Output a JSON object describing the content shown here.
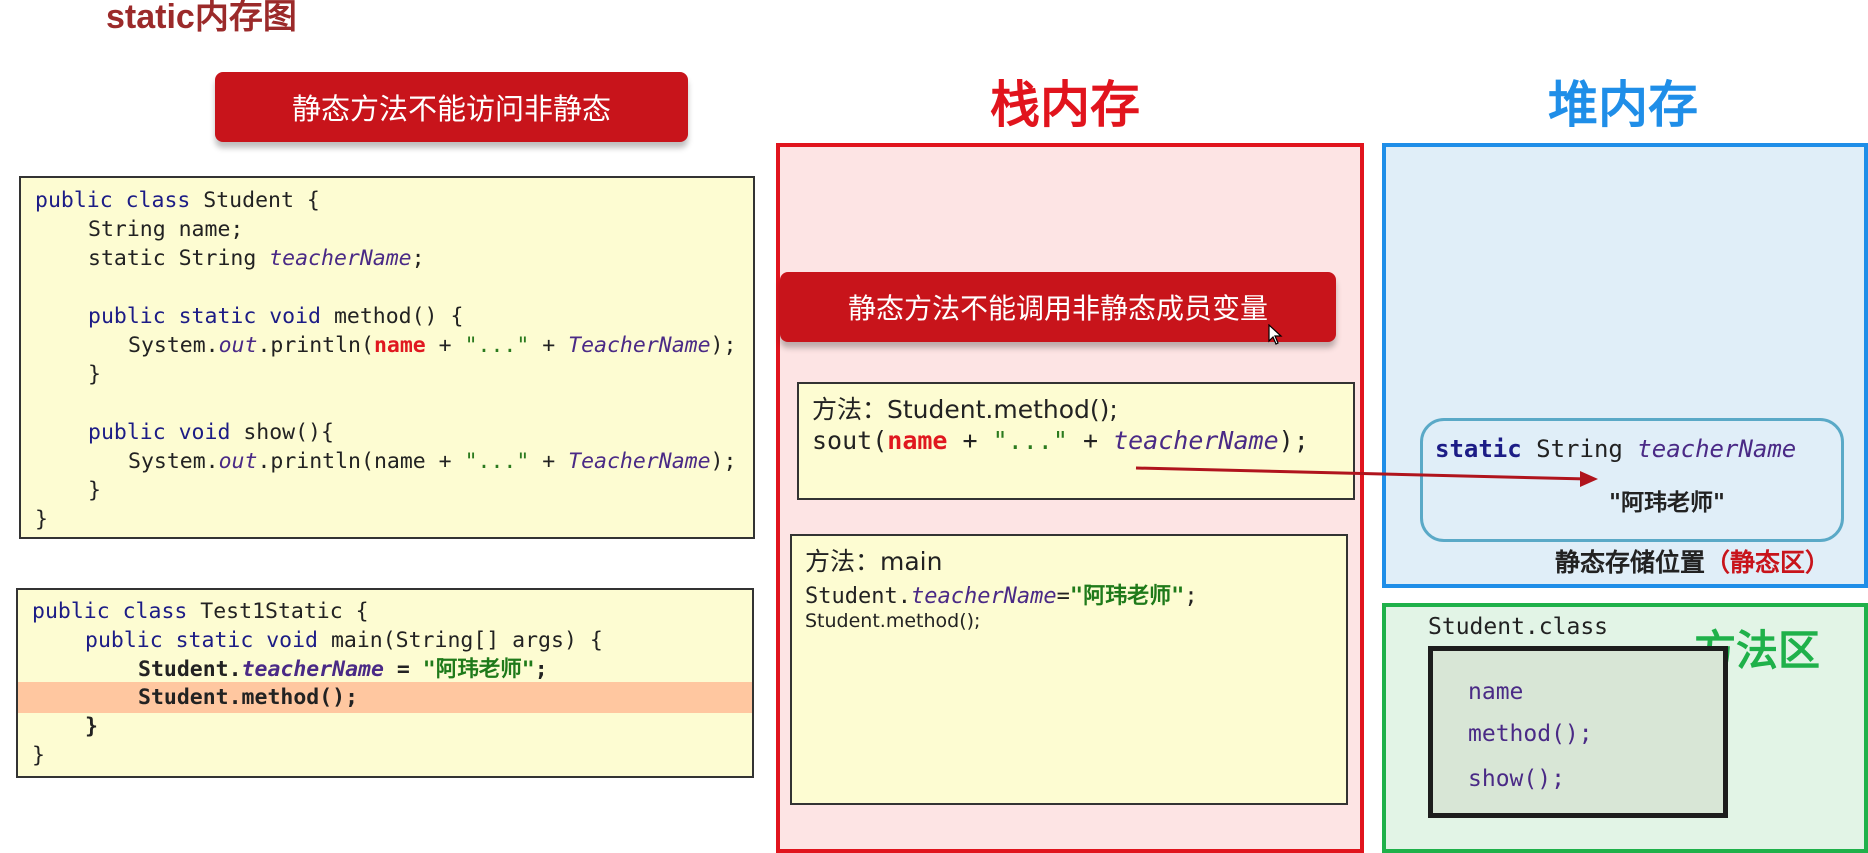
{
  "title": "static内存图",
  "left_banner": "静态方法不能访问非静态",
  "code_student": {
    "line1": [
      "public class",
      " Student {"
    ],
    "line2": [
      "String",
      " name;"
    ],
    "line3": [
      "static String ",
      "teacherName",
      ";"
    ],
    "line4": [
      "public static void",
      " method() {"
    ],
    "line5": [
      "System.",
      "out",
      ".println(",
      "name",
      " + ",
      "\"...\"",
      " + ",
      "TeacherName",
      ");"
    ],
    "line6": "}",
    "line7": [
      "public void",
      " show(){"
    ],
    "line8": [
      "System.",
      "out",
      ".println(name + ",
      "\"...\"",
      " + ",
      "TeacherName",
      ");"
    ],
    "line9": "}",
    "line10": "}"
  },
  "code_test": {
    "line1": [
      "public class",
      " Test1Static {"
    ],
    "line2": [
      "public static void",
      " main(String[] args) {"
    ],
    "line3": [
      "Student.",
      "teacherName",
      " = ",
      "\"阿玮老师\"",
      ";"
    ],
    "line4": "Student.method();",
    "line5": "}",
    "line6": "}"
  },
  "stack": {
    "title": "栈内存",
    "title_color": "#e1141d",
    "banner": "静态方法不能调用非静态成员变量",
    "frame_method": {
      "label": "方法：Student.method();",
      "code": [
        "sout(",
        "name",
        " + ",
        "\"...\"",
        " + ",
        "teacherName",
        ");"
      ]
    },
    "frame_main": {
      "label": "方法：main",
      "line1": [
        "Student.",
        "teacherName",
        "=",
        "\"阿玮老师\"",
        ";"
      ],
      "line2": "Student.method();"
    }
  },
  "heap": {
    "title": "堆内存",
    "title_color": "#1f8ee8",
    "static_field": [
      "static",
      " String ",
      "teacherName"
    ],
    "static_value": "\"阿玮老师\"",
    "area_label": "静态存储位置",
    "area_label_paren": "（静态区）"
  },
  "method_area": {
    "title": "方法区",
    "title_color": "#1fb14a",
    "class_name": "Student.class",
    "members": [
      "name",
      "method();",
      "show();"
    ]
  },
  "colors": {
    "accent_red": "#c8141b",
    "code_bg": "#fdfcd2",
    "highlight_row": "#ffc7a0",
    "arrow": "#b0141d"
  },
  "icons": {
    "cursor": "mouse-pointer-icon",
    "arrow": "reference-arrow-icon"
  }
}
